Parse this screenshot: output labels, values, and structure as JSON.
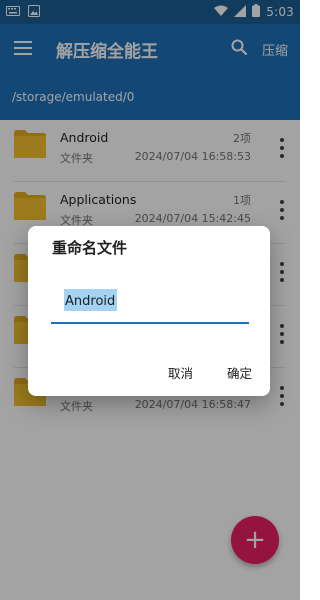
{
  "status_bar": {
    "time": "5:03",
    "icons": [
      "keyboard-icon",
      "image-icon",
      "wifi-icon",
      "signal-icon",
      "battery-icon"
    ]
  },
  "app_bar": {
    "title": "解压缩全能王",
    "compress_label": "压缩",
    "icons": [
      "menu-icon",
      "search-icon"
    ]
  },
  "path": "/storage/emulated/0",
  "files": [
    {
      "name": "Android",
      "type": "文件夹",
      "count": "2项",
      "date": "2024/07/04 16:58:53"
    },
    {
      "name": "Applications",
      "type": "文件夹",
      "count": "1项",
      "date": "2024/07/04 15:42:45"
    },
    {
      "name": "",
      "type": "",
      "count": "",
      "date": ""
    },
    {
      "name": "",
      "type": "",
      "count": "",
      "date": ""
    },
    {
      "name": "",
      "type": "文件夹",
      "count": "",
      "date": "2024/07/04 16:58:47"
    }
  ],
  "dialog": {
    "title": "重命名文件",
    "input_value": "Android",
    "cancel_label": "取消",
    "confirm_label": "确定"
  },
  "fab": {
    "icon": "plus-icon",
    "label": "+"
  },
  "colors": {
    "primary": "#1e70b8",
    "status_bar": "#1d5f94",
    "accent": "#e91e63",
    "folder": "#f2c12e",
    "selection": "#a3d2f5"
  }
}
